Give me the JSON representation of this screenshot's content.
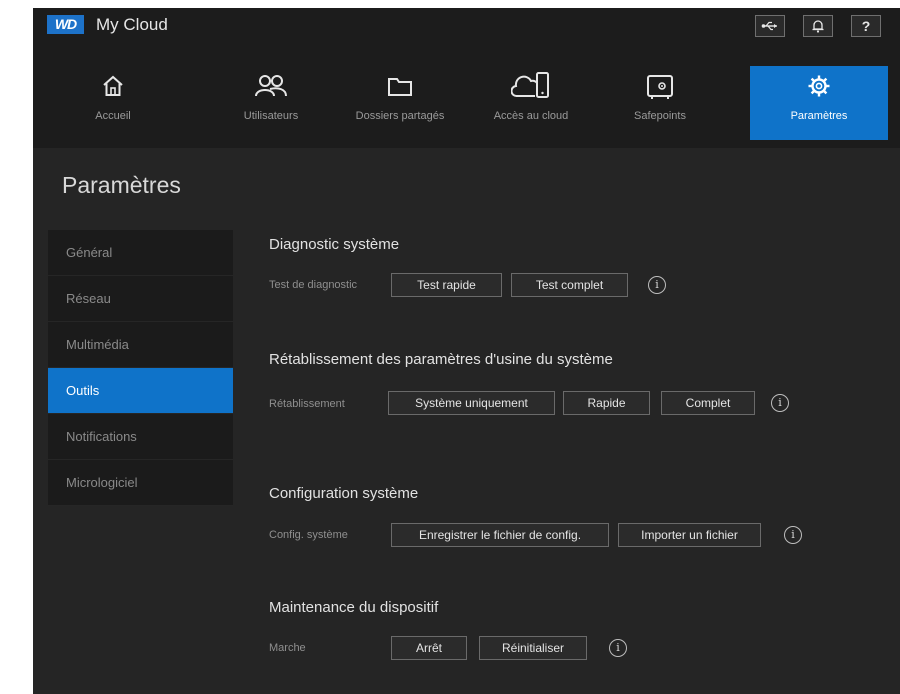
{
  "app": {
    "brand": "WD",
    "title": "My Cloud"
  },
  "topbar": {
    "usb_icon": "usb-icon",
    "bell_icon": "bell-icon",
    "help_label": "?"
  },
  "nav": [
    {
      "label": "Accueil",
      "icon": "home-icon"
    },
    {
      "label": "Utilisateurs",
      "icon": "users-icon"
    },
    {
      "label": "Dossiers partagés",
      "icon": "folder-icon"
    },
    {
      "label": "Accès au cloud",
      "icon": "cloud-device-icon"
    },
    {
      "label": "Safepoints",
      "icon": "safe-icon"
    },
    {
      "label": "Paramètres",
      "icon": "gear-icon",
      "active": true
    }
  ],
  "page_title": "Paramètres",
  "sidebar": [
    {
      "label": "Général"
    },
    {
      "label": "Réseau"
    },
    {
      "label": "Multimédia"
    },
    {
      "label": "Outils",
      "active": true
    },
    {
      "label": "Notifications"
    },
    {
      "label": "Micrologiciel"
    }
  ],
  "sections": {
    "diagnostic": {
      "title": "Diagnostic système",
      "label": "Test de diagnostic",
      "buttons": [
        "Test rapide",
        "Test complet"
      ]
    },
    "factory_reset": {
      "title": "Rétablissement des paramètres d'usine du système",
      "label": "Rétablissement",
      "buttons": [
        "Système uniquement",
        "Rapide",
        "Complet"
      ]
    },
    "config": {
      "title": "Configuration système",
      "label": "Config. système",
      "buttons": [
        "Enregistrer le fichier de config.",
        "Importer un fichier"
      ]
    },
    "maintenance": {
      "title": "Maintenance du dispositif",
      "label": "Marche",
      "buttons": [
        "Arrêt",
        "Réinitialiser"
      ]
    }
  },
  "info_glyph": "i",
  "colors": {
    "accent": "#0f73c9",
    "background": "#252525",
    "bar": "#1c1c1c"
  }
}
